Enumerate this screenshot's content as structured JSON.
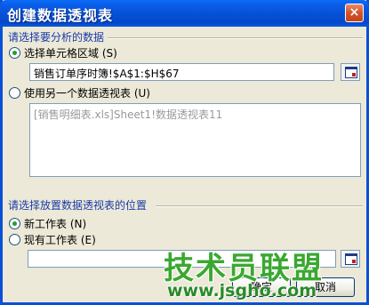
{
  "window": {
    "title": "创建数据透视表",
    "close_glyph": "×"
  },
  "data_section": {
    "label": "请选择要分析的数据",
    "option_range": {
      "label": "选择单元格区域 (S)",
      "checked": true
    },
    "range_value": "销售订单序时簿!$A$1:$H$67",
    "option_external": {
      "label": "使用另一个数据透视表 (U)",
      "checked": false
    },
    "external_value": "[销售明细表.xls]Sheet1!数据透视表11"
  },
  "location_section": {
    "label": "请选择放置数据透视表的位置",
    "option_new": {
      "label": "新工作表 (N)",
      "checked": true
    },
    "option_existing": {
      "label": "现有工作表 (E)",
      "checked": false
    },
    "location_value": ""
  },
  "buttons": {
    "ok_label": "确定",
    "cancel_label": "取消"
  },
  "watermark": {
    "title": "技术员联盟",
    "url": "www.jsgho.com"
  },
  "colors": {
    "title_bar": "#0a5ce8",
    "dialog_bg": "#ece9d8",
    "section_label": "#1a3aa8",
    "watermark_green": "#3aa830"
  },
  "icons": {
    "reference_button": "collapse-dialog-icon"
  }
}
